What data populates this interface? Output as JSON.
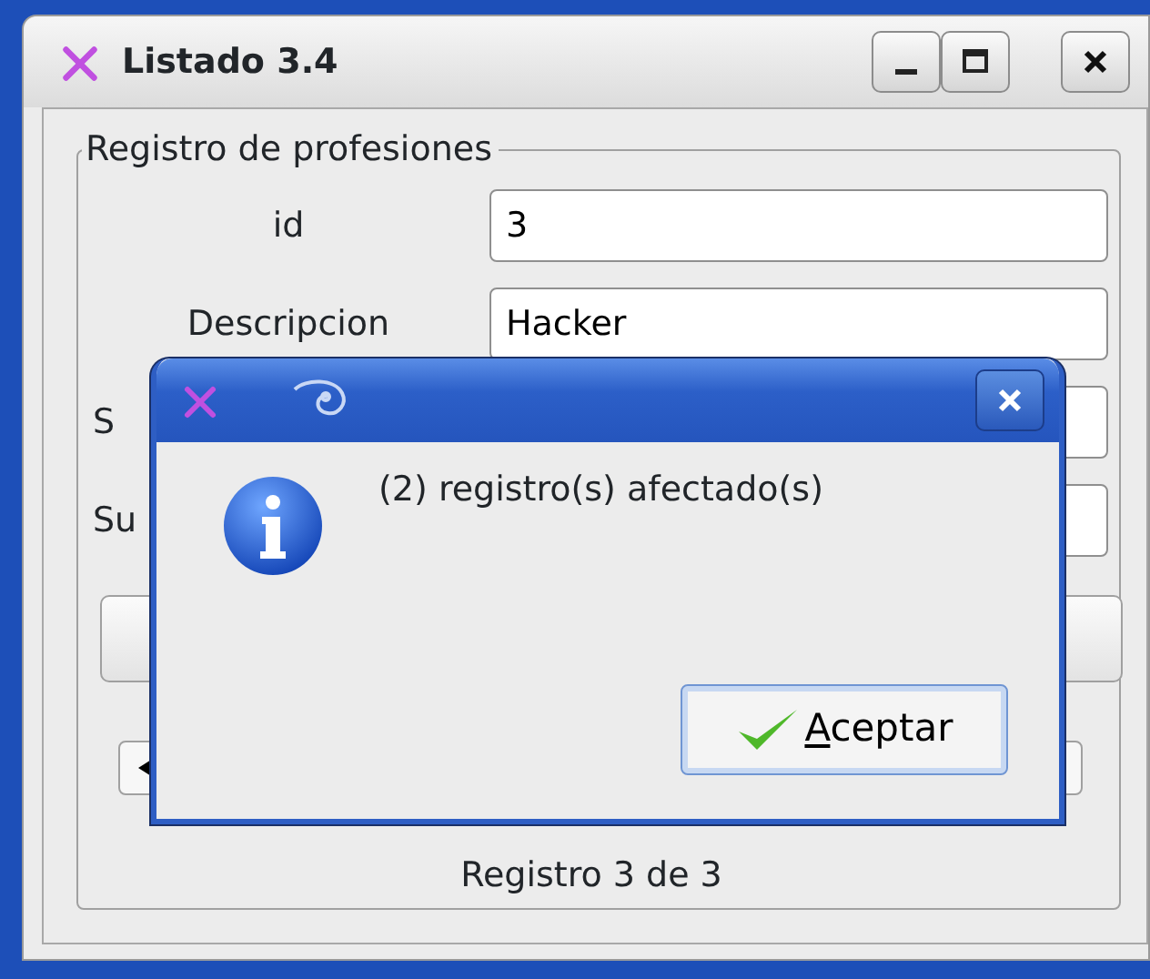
{
  "window": {
    "title": "Listado 3.4"
  },
  "group": {
    "title": "Registro de profesiones",
    "fields": [
      {
        "label": "id",
        "value": "3"
      },
      {
        "label": "Descripcion",
        "value": "Hacker"
      },
      {
        "label": "S"
      },
      {
        "label": "Su"
      }
    ]
  },
  "status": "Registro 3 de 3",
  "dialog": {
    "message": "(2) registro(s) afectado(s)",
    "button": "Aceptar"
  }
}
